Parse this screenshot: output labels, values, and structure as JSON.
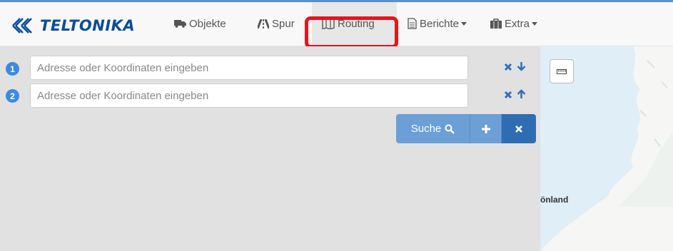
{
  "brand": {
    "logo_text": "TELTONIKA"
  },
  "nav": {
    "items": [
      {
        "label": "Objekte",
        "icon": "truck-icon"
      },
      {
        "label": "Spur",
        "icon": "road-icon"
      },
      {
        "label": "Routing",
        "icon": "map-icon",
        "active": true
      },
      {
        "label": "Berichte",
        "icon": "document-icon",
        "dropdown": true
      },
      {
        "label": "Extra",
        "icon": "briefcase-icon",
        "dropdown": true
      }
    ]
  },
  "routing": {
    "steps": [
      {
        "number": "1",
        "placeholder": "Adresse oder Koordinaten eingeben",
        "value": ""
      },
      {
        "number": "2",
        "placeholder": "Adresse oder Koordinaten eingeben",
        "value": ""
      }
    ],
    "search_label": "Suche"
  },
  "map": {
    "label_fragment": "önland"
  },
  "colors": {
    "brand": "#0b4c97",
    "accent": "#6b9fd6",
    "highlight": "#e8141b",
    "badge": "#3a8be0"
  }
}
